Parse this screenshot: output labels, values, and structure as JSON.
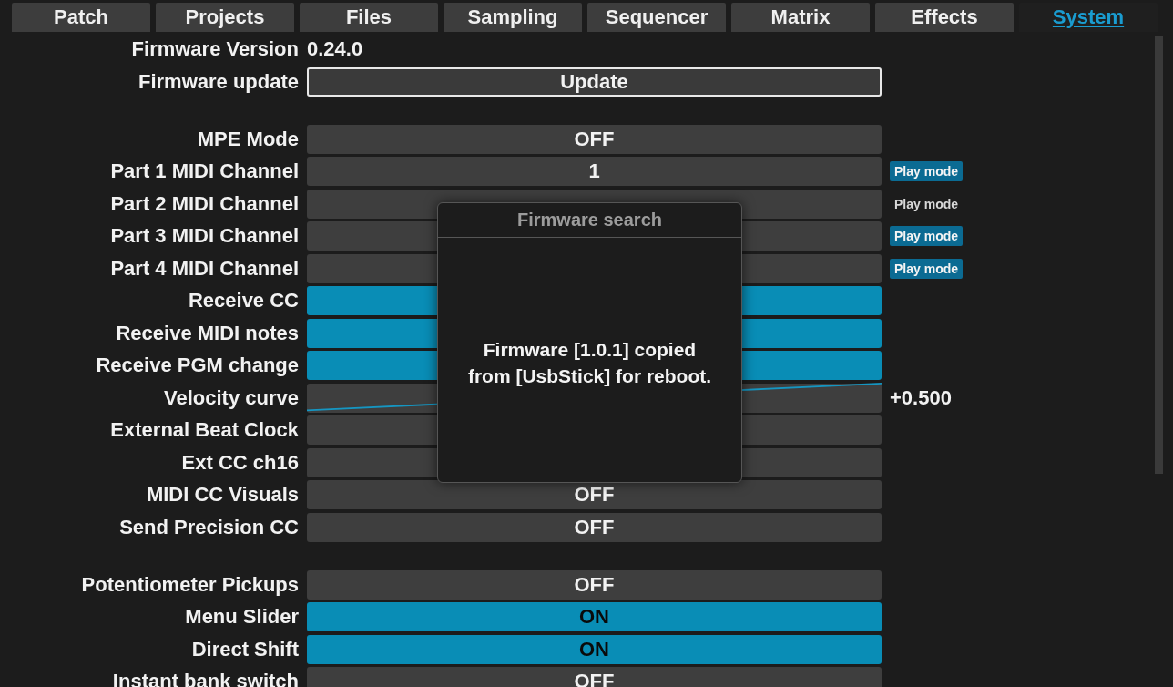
{
  "tabs": [
    {
      "label": "Patch",
      "selected": false
    },
    {
      "label": "Projects",
      "selected": false
    },
    {
      "label": "Files",
      "selected": false
    },
    {
      "label": "Sampling",
      "selected": false
    },
    {
      "label": "Sequencer",
      "selected": false
    },
    {
      "label": "Matrix",
      "selected": false
    },
    {
      "label": "Effects",
      "selected": false
    },
    {
      "label": "System",
      "selected": true
    }
  ],
  "settings": [
    {
      "kind": "info",
      "label": "Firmware Version",
      "value": "0.24.0"
    },
    {
      "kind": "button",
      "label": "Firmware update",
      "value": "Update"
    },
    {
      "kind": "gap"
    },
    {
      "kind": "field",
      "label": "MPE Mode",
      "on": false,
      "value": "OFF"
    },
    {
      "kind": "field",
      "label": "Part 1 MIDI Channel",
      "on": false,
      "value": "1",
      "badge": {
        "label": "Play mode",
        "selected": true
      }
    },
    {
      "kind": "field",
      "label": "Part 2 MIDI Channel",
      "on": false,
      "badge": {
        "label": "Play mode",
        "selected": false
      }
    },
    {
      "kind": "field",
      "label": "Part 3 MIDI Channel",
      "on": false,
      "badge": {
        "label": "Play mode",
        "selected": true
      }
    },
    {
      "kind": "field",
      "label": "Part 4 MIDI Channel",
      "on": false,
      "badge": {
        "label": "Play mode",
        "selected": true
      }
    },
    {
      "kind": "field",
      "label": "Receive CC",
      "on": true
    },
    {
      "kind": "field",
      "label": "Receive MIDI notes",
      "on": true
    },
    {
      "kind": "field",
      "label": "Receive PGM change",
      "on": true
    },
    {
      "kind": "curve",
      "label": "Velocity curve",
      "reading": "+0.500"
    },
    {
      "kind": "field",
      "label": "External Beat Clock",
      "on": false
    },
    {
      "kind": "field",
      "label": "Ext CC ch16",
      "on": false
    },
    {
      "kind": "field",
      "label": "MIDI CC Visuals",
      "on": false,
      "value": "OFF"
    },
    {
      "kind": "field",
      "label": "Send Precision CC",
      "on": false,
      "value": "OFF"
    },
    {
      "kind": "gap"
    },
    {
      "kind": "field",
      "label": "Potentiometer Pickups",
      "on": false,
      "value": "OFF"
    },
    {
      "kind": "field",
      "label": "Menu Slider",
      "on": true,
      "value": "ON"
    },
    {
      "kind": "field",
      "label": "Direct Shift",
      "on": true,
      "value": "ON"
    },
    {
      "kind": "field",
      "label": "Instant bank switch",
      "on": false,
      "value": "OFF"
    }
  ],
  "dialog": {
    "title": "Firmware search",
    "message": "Firmware [1.0.1] copied from [UsbStick] for reboot."
  }
}
